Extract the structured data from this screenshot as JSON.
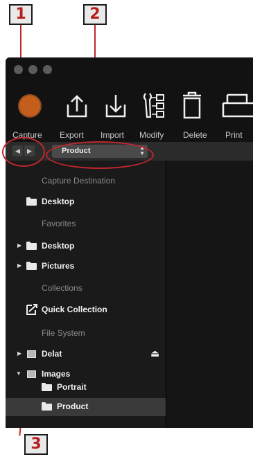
{
  "callouts": [
    "1",
    "2",
    "3"
  ],
  "toolbar": {
    "capture_label": "Capture",
    "export_label": "Export",
    "import_label": "Import",
    "modify_label": "Modify",
    "delete_label": "Delete",
    "print_label": "Print"
  },
  "nav": {
    "back_icon": "chevron-left-icon",
    "forward_icon": "chevron-right-icon",
    "select_value": "Product"
  },
  "sidebar": {
    "capture_destination": {
      "header": "Capture Destination",
      "items": [
        {
          "label": "Desktop",
          "icon": "folder-icon"
        }
      ]
    },
    "favorites": {
      "header": "Favorites",
      "items": [
        {
          "label": "Desktop",
          "icon": "folder-icon",
          "expanded": false
        },
        {
          "label": "Pictures",
          "icon": "folder-icon",
          "expanded": false
        }
      ]
    },
    "collections": {
      "header": "Collections",
      "items": [
        {
          "label": "Quick Collection",
          "icon": "quick-collection-icon"
        }
      ]
    },
    "file_system": {
      "header": "File System",
      "items": [
        {
          "label": "Delat",
          "icon": "drive-icon",
          "expanded": false,
          "eject": true
        },
        {
          "label": "Images",
          "icon": "drive-icon",
          "expanded": true,
          "children": [
            {
              "label": "Portrait",
              "icon": "folder-icon"
            },
            {
              "label": "Product",
              "icon": "folder-icon",
              "selected": true
            }
          ]
        }
      ]
    }
  },
  "colors": {
    "callout_accent": "#c0272d",
    "capture_button": "#c45e1c",
    "selected_row": "#3a3a3a"
  }
}
